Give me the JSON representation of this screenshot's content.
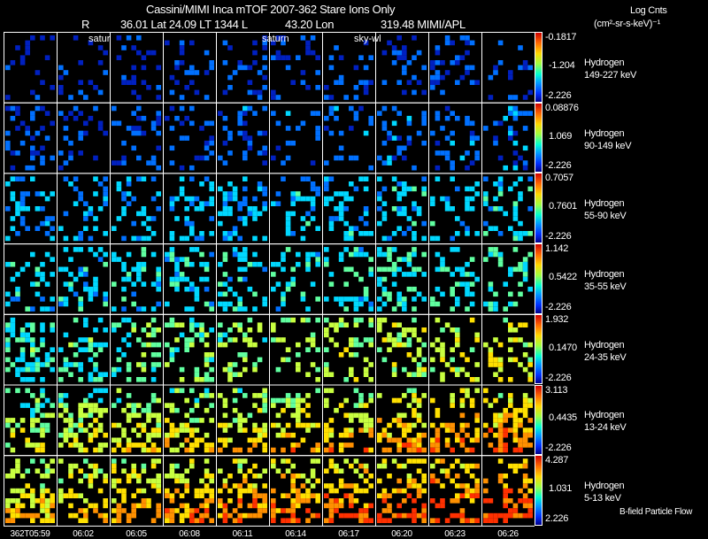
{
  "header": {
    "title": "Cassini/MIMI Inca mTOF  2007-362   Stare   Ions Only",
    "sub_r": "R",
    "sub_lat": "36.01 Lat 24.09 LT 1344 L",
    "sub_lon": "43.20 Lon",
    "sub_right": "319.48  MIMI/APL",
    "units_line1": "Log Cnts",
    "units_line2": "(cm²-sr-s-keV)⁻¹"
  },
  "overlays": [
    "satur",
    "saturn",
    "sky-wl"
  ],
  "footer_note": "B-field Particle Flow",
  "chart_data": {
    "type": "heatmap",
    "title": "Cassini/MIMI Inca mTOF  2007-362   Stare   Ions Only",
    "colorbar_label": "Log Cnts (cm²-sr-s-keV)⁻¹",
    "time_labels": [
      "362T05:59",
      "06:02",
      "06:05",
      "06:08",
      "06:11",
      "06:14",
      "06:17",
      "06:20",
      "06:23",
      "06:26"
    ],
    "rows": [
      {
        "species": "Hydrogen",
        "energy": "149-227 keV",
        "cbar_max": "-0.1817",
        "cbar_mid": "-1.204",
        "cbar_min": "-2.226",
        "level": 0.15
      },
      {
        "species": "Hydrogen",
        "energy": "90-149 keV",
        "cbar_max": "0.08876",
        "cbar_mid": "1.069",
        "cbar_min": "-2.226",
        "level": 0.2
      },
      {
        "species": "Hydrogen",
        "energy": "55-90 keV",
        "cbar_max": "0.7057",
        "cbar_mid": "0.7601",
        "cbar_min": "-2.226",
        "level": 0.35
      },
      {
        "species": "Hydrogen",
        "energy": "35-55 keV",
        "cbar_max": "1.142",
        "cbar_mid": "0.5422",
        "cbar_min": "-2.226",
        "level": 0.42
      },
      {
        "species": "Hydrogen",
        "energy": "24-35 keV",
        "cbar_max": "1.932",
        "cbar_mid": "0.1470",
        "cbar_min": "-2.226",
        "level": 0.5
      },
      {
        "species": "Hydrogen",
        "energy": "13-24 keV",
        "cbar_max": "3.113",
        "cbar_mid": "0.4435",
        "cbar_min": "-2.226",
        "level": 0.6
      },
      {
        "species": "Hydrogen",
        "energy": "5-13 keV",
        "cbar_max": "4.287",
        "cbar_mid": "1.031",
        "cbar_min": "2.226",
        "level": 0.72
      }
    ]
  }
}
